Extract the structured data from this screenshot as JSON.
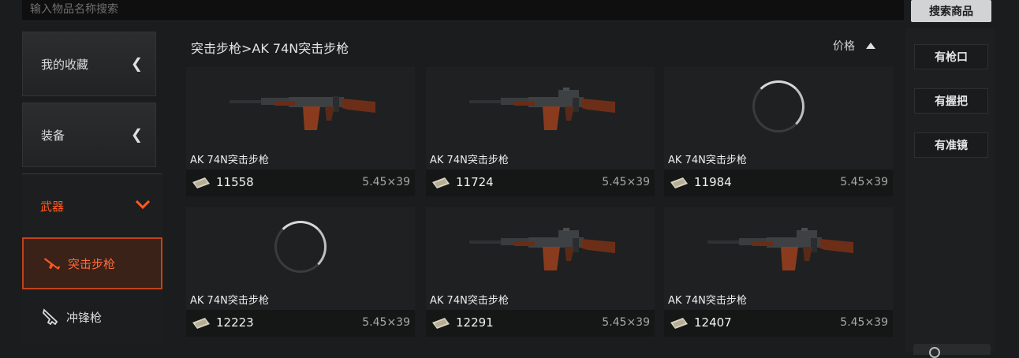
{
  "search": {
    "placeholder": "输入物品名称搜索",
    "button_label": "搜索商品"
  },
  "sidebar": {
    "categories": [
      {
        "label": "我的收藏",
        "expanded": false
      },
      {
        "label": "装备",
        "expanded": false
      },
      {
        "label": "武器",
        "expanded": true
      }
    ],
    "subitems": [
      {
        "label": "突击步枪",
        "icon": "rifle-icon",
        "active": true
      },
      {
        "label": "冲锋枪",
        "icon": "smg-icon",
        "active": false
      }
    ]
  },
  "main": {
    "breadcrumb": "突击步枪>AK 74N突击步枪",
    "sort_label": "价格",
    "sort_direction": "ascending"
  },
  "items": [
    {
      "name": "AK 74N突击步枪",
      "price": "11558",
      "caliber": "5.45×39",
      "image": "rifle",
      "scope": false
    },
    {
      "name": "AK 74N突击步枪",
      "price": "11724",
      "caliber": "5.45×39",
      "image": "rifle",
      "scope": true
    },
    {
      "name": "AK 74N突击步枪",
      "price": "11984",
      "caliber": "5.45×39",
      "image": "loading"
    },
    {
      "name": "AK 74N突击步枪",
      "price": "12223",
      "caliber": "5.45×39",
      "image": "loading"
    },
    {
      "name": "AK 74N突击步枪",
      "price": "12291",
      "caliber": "5.45×39",
      "image": "rifle",
      "scope": true
    },
    {
      "name": "AK 74N突击步枪",
      "price": "12407",
      "caliber": "5.45×39",
      "image": "rifle",
      "scope": true
    }
  ],
  "filters": [
    {
      "label": "有枪口"
    },
    {
      "label": "有握把"
    },
    {
      "label": "有准镜"
    }
  ],
  "colors": {
    "accent": "#ff5a21",
    "active_bg": "#3a2219",
    "background": "#1b1c1d"
  }
}
